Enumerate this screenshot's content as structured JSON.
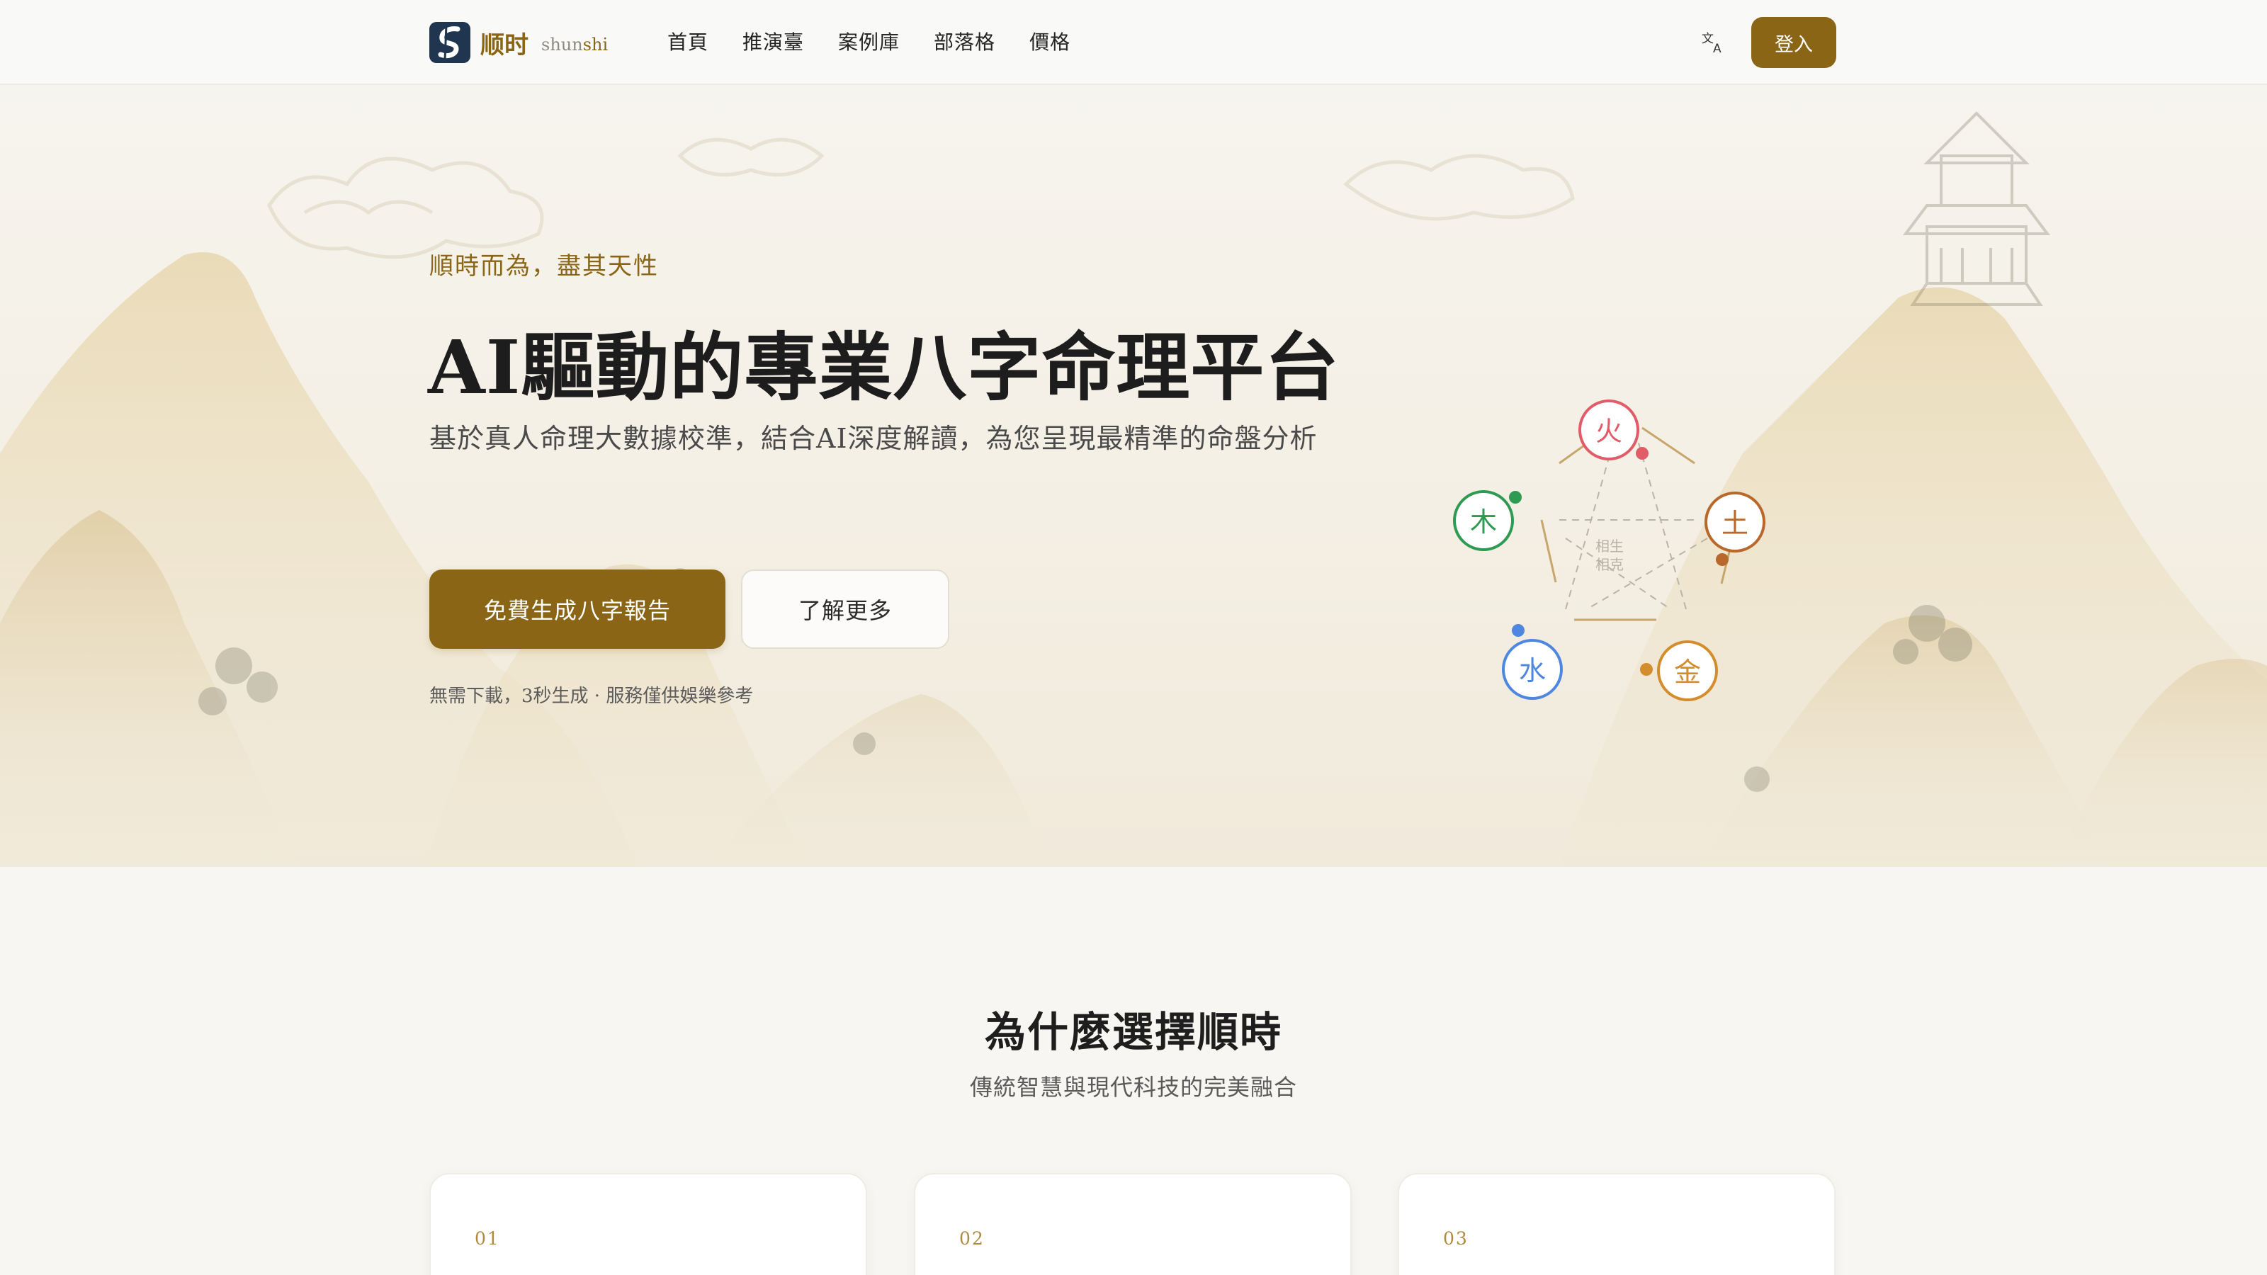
{
  "header": {
    "brand_cn": "顺时",
    "brand_en_a": "shun",
    "brand_en_b": "shi",
    "nav": [
      {
        "label": "首頁"
      },
      {
        "label": "推演臺"
      },
      {
        "label": "案例庫"
      },
      {
        "label": "部落格"
      },
      {
        "label": "價格"
      }
    ],
    "lang_icon": "translate-icon",
    "login_label": "登入"
  },
  "hero": {
    "tagline": "順時而為，盡其天性",
    "title": "AI驅動的專業八字命理平台",
    "description": "基於真人命理大數據校準，結合AI深度解讀，為您呈現最精準的命盤分析",
    "primary_cta": "免費生成八字報告",
    "secondary_cta": "了解更多",
    "note": "無需下載，3秒生成 · 服務僅供娛樂參考"
  },
  "wuxing": {
    "elements": [
      {
        "label": "火",
        "color": "#e05c68"
      },
      {
        "label": "土",
        "color": "#b7682a"
      },
      {
        "label": "金",
        "color": "#d48d2c"
      },
      {
        "label": "水",
        "color": "#4e87e0"
      },
      {
        "label": "木",
        "color": "#2f9a51"
      }
    ],
    "legend_generate": "相生",
    "legend_overcome": "相克",
    "generate_color": "#c6a66b",
    "overcome_color": "#b9b4a8"
  },
  "features": {
    "title": "為什麼選擇順時",
    "subtitle": "傳統智慧與現代科技的完美融合",
    "cards": [
      {
        "num": "01"
      },
      {
        "num": "02"
      },
      {
        "num": "03"
      }
    ]
  },
  "colors": {
    "accent": "#8a6516",
    "logo_bg": "#1f3550"
  }
}
